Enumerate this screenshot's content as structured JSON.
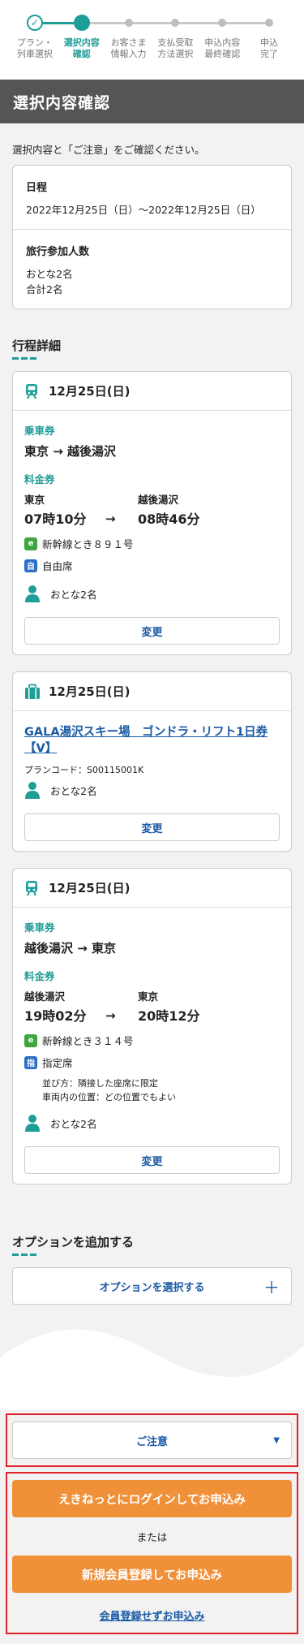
{
  "stepper": {
    "steps": [
      {
        "label1": "プラン・",
        "label2": "列車選択",
        "state": "done"
      },
      {
        "label1": "選択内容",
        "label2": "確認",
        "state": "current"
      },
      {
        "label1": "お客さま",
        "label2": "情報入力",
        "state": "todo"
      },
      {
        "label1": "支払受取",
        "label2": "方法選択",
        "state": "todo"
      },
      {
        "label1": "申込内容",
        "label2": "最終確認",
        "state": "todo"
      },
      {
        "label1": "申込",
        "label2": "完了",
        "state": "todo"
      }
    ],
    "check_glyph": "✓"
  },
  "page_title": "選択内容確認",
  "intro": "選択内容と「ご注意」をご確認ください。",
  "summary": {
    "date_label": "日程",
    "date_value": "2022年12月25日（日）～2022年12月25日（日）",
    "people_label": "旅行参加人数",
    "people_line1": "おとな2名",
    "people_line2": "合計2名"
  },
  "itinerary": {
    "title": "行程詳細",
    "train1": {
      "date": "12月25日(日)",
      "ticket_label": "乗車券",
      "route": "東京 → 越後湯沢",
      "fare_label": "料金券",
      "dep_station": "東京",
      "dep_time": "07時10分",
      "arrow": "→",
      "arr_station": "越後湯沢",
      "arr_time": "08時46分",
      "train_name": "新幹線とき８９１号",
      "seat_type": "自由席",
      "seat_badge": "自",
      "passengers": "おとな2名",
      "change_label": "変更"
    },
    "plan": {
      "date": "12月25日(日)",
      "name": "GALA湯沢スキー場　ゴンドラ・リフト1日券【V】",
      "code": "プランコード：S00115001K",
      "passengers": "おとな2名",
      "change_label": "変更"
    },
    "train2": {
      "date": "12月25日(日)",
      "ticket_label": "乗車券",
      "route": "越後湯沢 → 東京",
      "fare_label": "料金券",
      "dep_station": "越後湯沢",
      "dep_time": "19時02分",
      "arrow": "→",
      "arr_station": "東京",
      "arr_time": "20時12分",
      "train_name": "新幹線とき３１４号",
      "seat_type": "指定席",
      "seat_badge": "指",
      "seat_note1": "並び方：隣接した座席に限定",
      "seat_note2": "車両内の位置：どの位置でもよい",
      "passengers": "おとな2名",
      "change_label": "変更"
    }
  },
  "options": {
    "title": "オプションを追加する",
    "select_label": "オプションを選択する",
    "plus": "＋"
  },
  "notice": {
    "label": "ご注意",
    "caret": "▼"
  },
  "cta": {
    "login_label": "えきねっとにログインしてお申込み",
    "or_label": "または",
    "register_label": "新規会員登録してお申込み",
    "guest_label": "会員登録せずお申込み"
  },
  "colors": {
    "accent": "#1f9e98",
    "link": "#1a5aa6",
    "cta": "#f0913a",
    "highlight": "#e0202a",
    "title_bar": "#555555"
  }
}
